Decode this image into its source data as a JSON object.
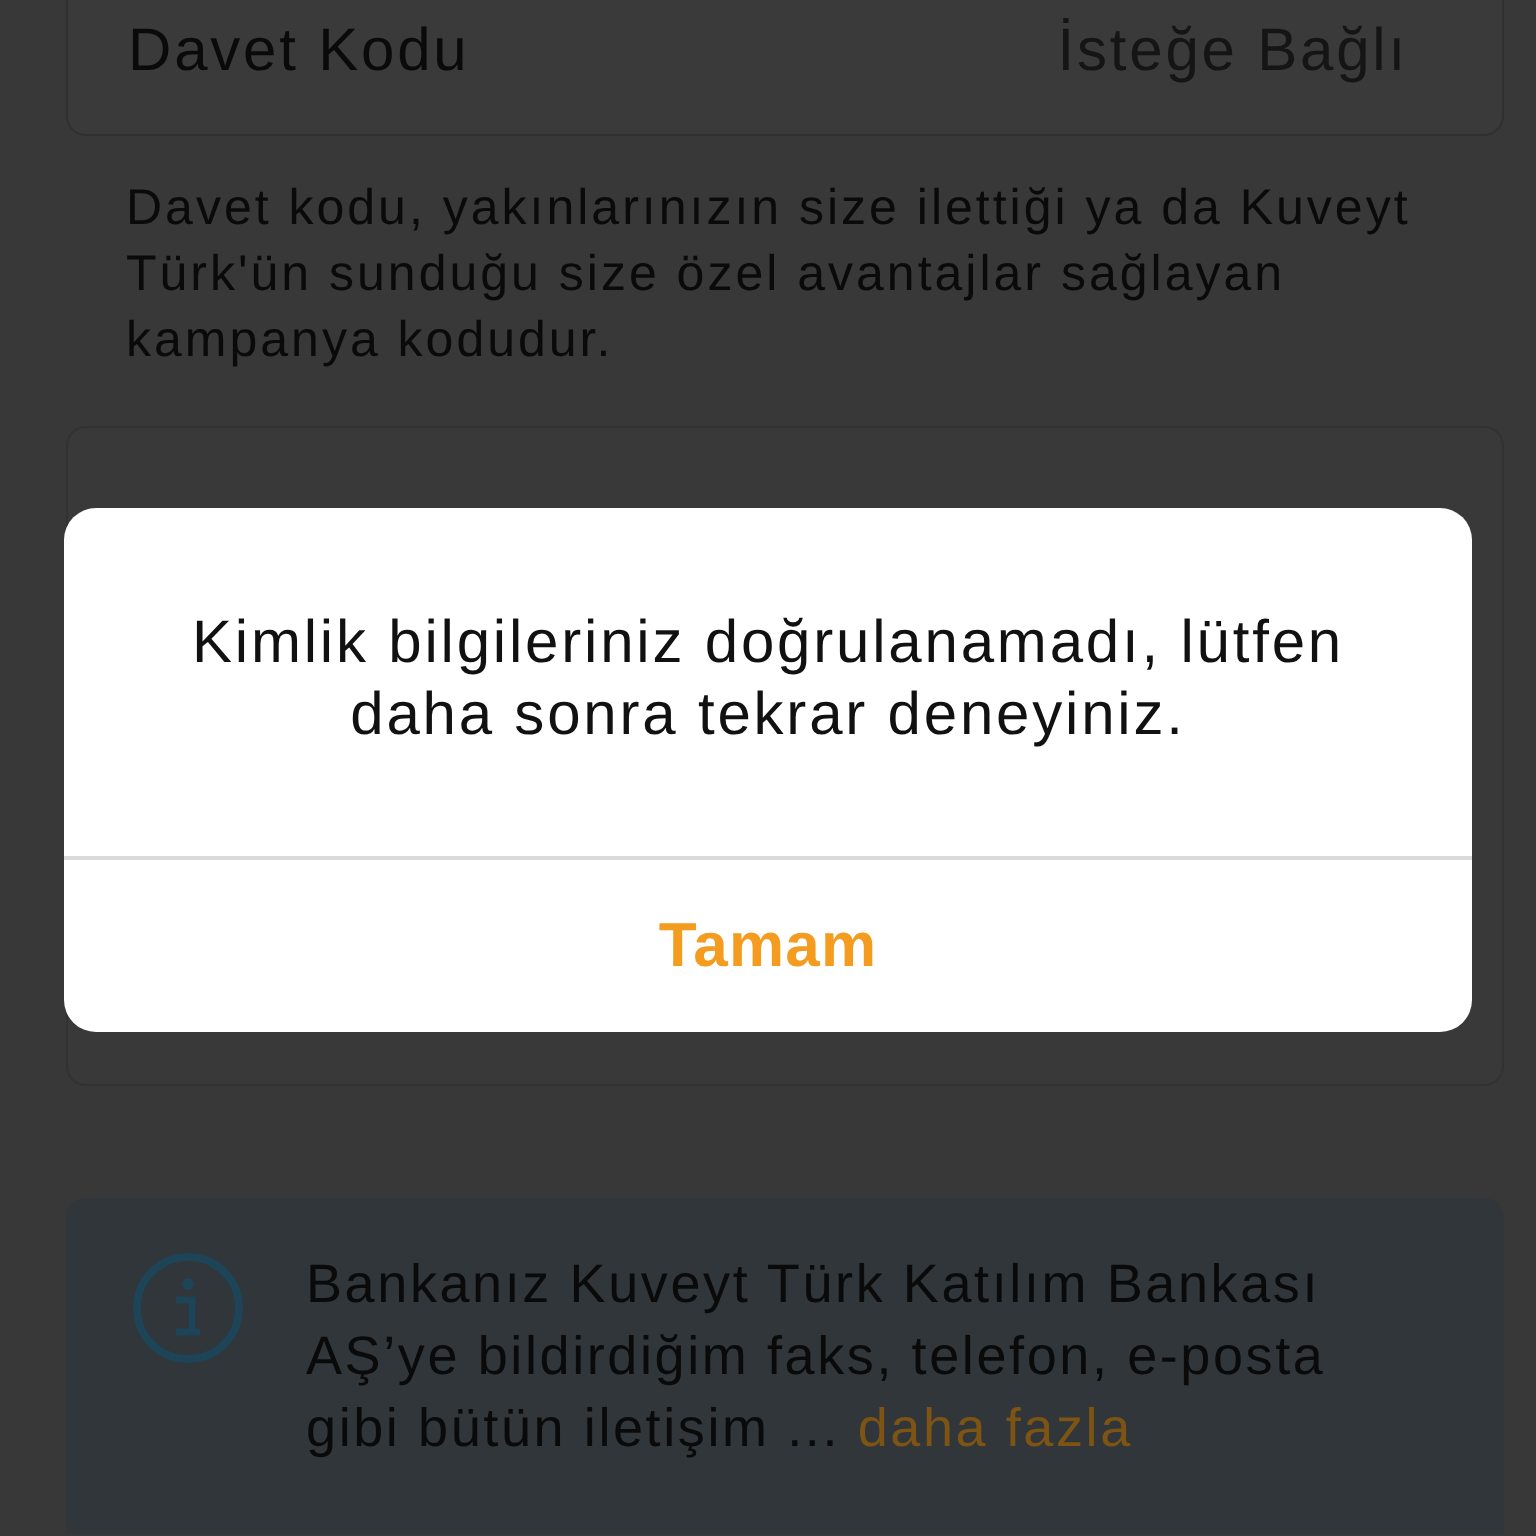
{
  "form_field": {
    "label": "Davet Kodu",
    "placeholder": "İsteğe Bağlı"
  },
  "field_hint": "Davet kodu, yakınlarınızın size ilettiği ya da Kuveyt Türk'ün sunduğu size özel avantajlar sağlayan kampanya kodudur.",
  "alert": {
    "message": "Kimlik bilgileriniz doğrulanamadı, lütfen daha sonra tekrar deneyiniz.",
    "buttons": [
      {
        "label": "Tamam"
      }
    ]
  },
  "info_box": {
    "text": "Bankanız Kuveyt Türk Katılım Bankası AŞ’ye bildirdiğim faks, telefon, e-posta gibi bütün iletişim ...",
    "link": "daha fazla"
  }
}
